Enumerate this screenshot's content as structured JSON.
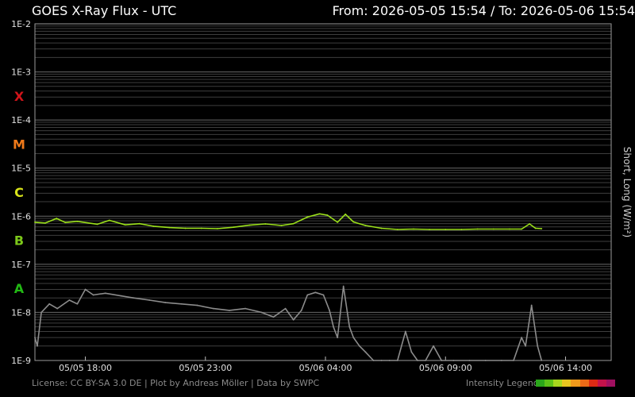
{
  "header": {
    "title": "GOES X-Ray Flux - UTC",
    "range_text": "From: 2026-05-05 15:54  /  To: 2026-05-06 15:54"
  },
  "footer": {
    "credits": "License: CC BY-SA 3.0 DE | Plot by Andreas Möller | Data by SWPC",
    "legend_label": "Intensity Legend",
    "legend_colors": [
      "#2aa61a",
      "#5cc117",
      "#a8d71e",
      "#e6c51f",
      "#f09a1b",
      "#ea6a17",
      "#dc2a14",
      "#c4124a",
      "#a01060"
    ]
  },
  "colors": {
    "background": "#000000",
    "grid": "#555555",
    "long_channel": "#9be01a",
    "short_channel": "#8c8c8c",
    "class_X": "#d0141a",
    "class_M": "#f07a1a",
    "class_C": "#d8e41a",
    "class_B": "#7cc81a",
    "class_A": "#22b814"
  },
  "chart_data": {
    "type": "line",
    "title": "GOES X-Ray Flux - UTC",
    "ylabel": "Short, Long (W/m²)",
    "xlabel": "",
    "yscale": "log",
    "ylim": [
      "1E-9",
      "1E-2"
    ],
    "y_ticks": [
      "1E-2",
      "1E-3",
      "1E-4",
      "1E-5",
      "1E-6",
      "1E-7",
      "1E-8",
      "1E-9"
    ],
    "x_ticks": [
      "05/05 18:00",
      "05/05 23:00",
      "05/06 04:00",
      "05/06 09:00",
      "05/06 14:00"
    ],
    "x_range": [
      "2026-05-05 15:54",
      "2026-05-06 15:54"
    ],
    "flare_classes": [
      {
        "label": "X",
        "from": "1E-4",
        "to": "1E-3"
      },
      {
        "label": "M",
        "from": "1E-5",
        "to": "1E-4"
      },
      {
        "label": "C",
        "from": "1E-6",
        "to": "1E-5"
      },
      {
        "label": "B",
        "from": "1E-7",
        "to": "1E-6"
      },
      {
        "label": "A",
        "from": "1E-8",
        "to": "1E-7"
      }
    ],
    "grid": true,
    "series": [
      {
        "name": "Long",
        "x": [
          "2026-05-05 15:54",
          "2026-05-05 16:20",
          "2026-05-05 16:48",
          "2026-05-05 17:10",
          "2026-05-05 17:40",
          "2026-05-05 18:30",
          "2026-05-05 19:00",
          "2026-05-05 19:40",
          "2026-05-05 20:15",
          "2026-05-05 20:50",
          "2026-05-05 21:30",
          "2026-05-05 22:10",
          "2026-05-05 22:50",
          "2026-05-05 23:30",
          "2026-05-06 00:10",
          "2026-05-06 00:50",
          "2026-05-06 01:30",
          "2026-05-06 02:10",
          "2026-05-06 02:40",
          "2026-05-06 03:15",
          "2026-05-06 03:45",
          "2026-05-06 04:05",
          "2026-05-06 04:30",
          "2026-05-06 04:50",
          "2026-05-06 05:10",
          "2026-05-06 05:40",
          "2026-05-06 06:20",
          "2026-05-06 07:00",
          "2026-05-06 07:40",
          "2026-05-06 08:20",
          "2026-05-06 09:00",
          "2026-05-06 09:40",
          "2026-05-06 10:20",
          "2026-05-06 11:00",
          "2026-05-06 11:40",
          "2026-05-06 12:10",
          "2026-05-06 12:30",
          "2026-05-06 12:45",
          "2026-05-06 13:00"
        ],
        "y": [
          7.5e-07,
          7.2e-07,
          9e-07,
          7.4e-07,
          7.8e-07,
          6.8e-07,
          8.2e-07,
          6.6e-07,
          7e-07,
          6.2e-07,
          5.8e-07,
          5.6e-07,
          5.6e-07,
          5.5e-07,
          5.9e-07,
          6.5e-07,
          6.9e-07,
          6.4e-07,
          7e-07,
          9.6e-07,
          1.12e-06,
          1.05e-06,
          7.5e-07,
          1.1e-06,
          7.6e-07,
          6.4e-07,
          5.6e-07,
          5.3e-07,
          5.4e-07,
          5.3e-07,
          5.3e-07,
          5.3e-07,
          5.4e-07,
          5.4e-07,
          5.4e-07,
          5.4e-07,
          6.9e-07,
          5.6e-07,
          5.5e-07
        ]
      },
      {
        "name": "Short",
        "x": [
          "2026-05-05 15:54",
          "2026-05-05 16:00",
          "2026-05-05 16:10",
          "2026-05-05 16:30",
          "2026-05-05 16:50",
          "2026-05-05 17:20",
          "2026-05-05 17:40",
          "2026-05-05 18:00",
          "2026-05-05 18:20",
          "2026-05-05 18:50",
          "2026-05-05 19:30",
          "2026-05-05 20:00",
          "2026-05-05 20:40",
          "2026-05-05 21:20",
          "2026-05-05 22:00",
          "2026-05-05 22:40",
          "2026-05-05 23:20",
          "2026-05-06 00:00",
          "2026-05-06 00:40",
          "2026-05-06 01:20",
          "2026-05-06 01:50",
          "2026-05-06 02:20",
          "2026-05-06 02:40",
          "2026-05-06 03:00",
          "2026-05-06 03:15",
          "2026-05-06 03:35",
          "2026-05-06 03:55",
          "2026-05-06 04:10",
          "2026-05-06 04:20",
          "2026-05-06 04:30",
          "2026-05-06 04:45",
          "2026-05-06 05:00",
          "2026-05-06 05:10",
          "2026-05-06 05:25",
          "2026-05-06 05:40",
          "2026-05-06 06:00",
          "2026-05-06 06:20",
          "2026-05-06 06:40",
          "2026-05-06 07:00",
          "2026-05-06 07:20",
          "2026-05-06 07:35",
          "2026-05-06 07:50",
          "2026-05-06 08:10",
          "2026-05-06 08:30",
          "2026-05-06 08:50",
          "2026-05-06 09:20",
          "2026-05-06 10:00",
          "2026-05-06 10:40",
          "2026-05-06 11:20",
          "2026-05-06 11:50",
          "2026-05-06 12:10",
          "2026-05-06 12:20",
          "2026-05-06 12:35",
          "2026-05-06 12:50",
          "2026-05-06 13:00"
        ],
        "y": [
          3e-09,
          2e-09,
          1e-08,
          1.5e-08,
          1.2e-08,
          1.8e-08,
          1.5e-08,
          3e-08,
          2.3e-08,
          2.5e-08,
          2.2e-08,
          2e-08,
          1.8e-08,
          1.6e-08,
          1.5e-08,
          1.4e-08,
          1.2e-08,
          1.1e-08,
          1.2e-08,
          1e-08,
          8e-09,
          1.2e-08,
          7e-09,
          1.1e-08,
          2.3e-08,
          2.6e-08,
          2.3e-08,
          1.1e-08,
          5e-09,
          3e-09,
          3.5e-08,
          5e-09,
          3e-09,
          2e-09,
          1.5e-09,
          1e-09,
          1e-09,
          1e-09,
          1e-09,
          4e-09,
          1.5e-09,
          1e-09,
          1e-09,
          2e-09,
          1e-09,
          1e-09,
          1e-09,
          1e-09,
          1e-09,
          1e-09,
          3e-09,
          2e-09,
          1.4e-08,
          2e-09,
          1e-09
        ]
      }
    ]
  }
}
